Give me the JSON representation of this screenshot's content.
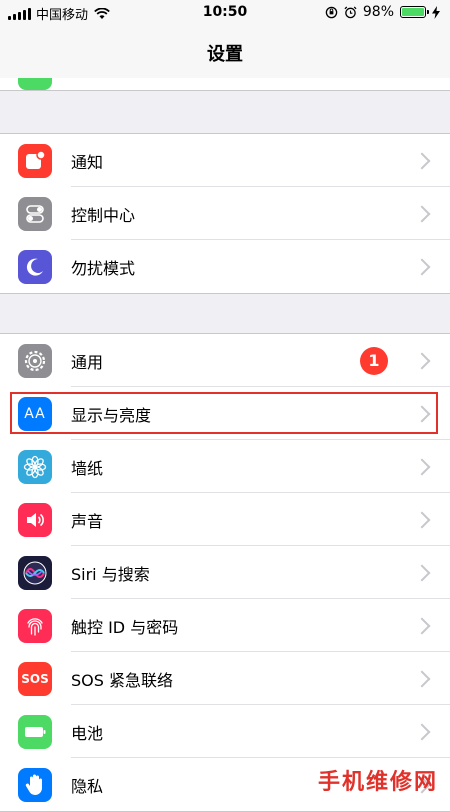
{
  "status": {
    "carrier": "中国移动",
    "time": "10:50",
    "battery": "98%",
    "battery_level": 0.98
  },
  "nav": {
    "title": "设置"
  },
  "groups": [
    {
      "items": [
        {
          "label": "通知",
          "icon": "notifications-icon",
          "color": "#ff3b30"
        },
        {
          "label": "控制中心",
          "icon": "control-center-icon",
          "color": "#8e8e93"
        },
        {
          "label": "勿扰模式",
          "icon": "moon-icon",
          "color": "#5856d6"
        }
      ]
    },
    {
      "items": [
        {
          "label": "通用",
          "icon": "gear-icon",
          "color": "#8e8e93",
          "badge": "1"
        },
        {
          "label": "显示与亮度",
          "icon": "display-brightness-icon",
          "color": "#007aff",
          "icon_text": "AA"
        },
        {
          "label": "墙纸",
          "icon": "wallpaper-flower-icon",
          "color": "#34aadc"
        },
        {
          "label": "声音",
          "icon": "speaker-icon",
          "color": "#ff2d55"
        },
        {
          "label": "Siri 与搜索",
          "icon": "siri-icon",
          "color": "#1b1b3a"
        },
        {
          "label": "触控 ID 与密码",
          "icon": "fingerprint-icon",
          "color": "#ff2d55"
        },
        {
          "label": "SOS 紧急联络",
          "icon": "sos-icon",
          "color": "#ff3b30",
          "icon_text": "SOS"
        },
        {
          "label": "电池",
          "icon": "battery-icon",
          "color": "#4cd964"
        },
        {
          "label": "隐私",
          "icon": "hand-icon",
          "color": "#007aff"
        }
      ]
    }
  ],
  "watermark": "手机维修网"
}
